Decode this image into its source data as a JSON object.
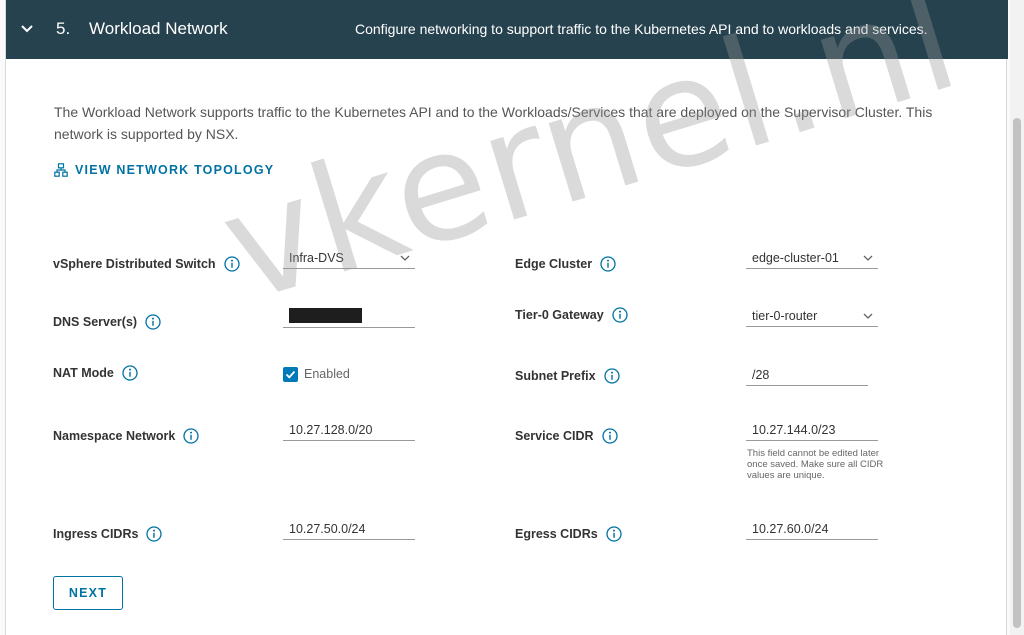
{
  "header": {
    "step_number": "5.",
    "title": "Workload Network",
    "description": "Configure networking to support traffic to the Kubernetes API and to workloads and services."
  },
  "intro": "The Workload Network supports traffic to the Kubernetes API and to the Workloads/Services that are deployed on the Supervisor Cluster. This network is supported by NSX.",
  "topology_link": "VIEW NETWORK TOPOLOGY",
  "fields": {
    "vds": {
      "label": "vSphere Distributed Switch",
      "value": "Infra-DVS"
    },
    "dns": {
      "label": "DNS Server(s)",
      "value": ""
    },
    "nat": {
      "label": "NAT Mode",
      "checkbox_label": "Enabled",
      "checked": true
    },
    "namespace": {
      "label": "Namespace Network",
      "value": "10.27.128.0/20"
    },
    "ingress": {
      "label": "Ingress CIDRs",
      "value": "10.27.50.0/24"
    },
    "edge": {
      "label": "Edge Cluster",
      "value": "edge-cluster-01"
    },
    "tier0": {
      "label": "Tier-0 Gateway",
      "value": "tier-0-router"
    },
    "subnet": {
      "label": "Subnet Prefix",
      "value": "/28"
    },
    "service": {
      "label": "Service CIDR",
      "value": "10.27.144.0/23",
      "helper": "This field cannot be edited later once saved. Make sure all CIDR values are unique."
    },
    "egress": {
      "label": "Egress CIDRs",
      "value": "10.27.60.0/24"
    }
  },
  "next_label": "NEXT",
  "watermark": "vkernel.nl",
  "colors": {
    "header_bg": "#27424f",
    "accent": "#0072a3",
    "checkbox": "#0079b8"
  },
  "icons": [
    "chevron-down-icon",
    "network-topology-icon",
    "info-icon",
    "caret-down-icon",
    "checkmark-icon"
  ]
}
